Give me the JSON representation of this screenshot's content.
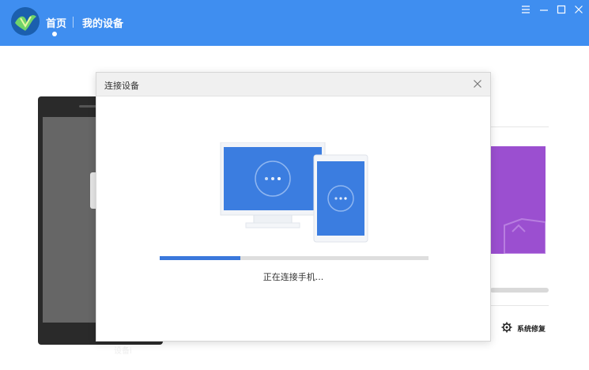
{
  "header": {
    "nav": [
      {
        "label": "首页",
        "active": true
      },
      {
        "label": "我的设备",
        "active": false
      }
    ],
    "window_controls": [
      "menu-icon",
      "minimize-icon",
      "maximize-icon",
      "close-icon"
    ]
  },
  "background": {
    "phone_label": "设备i",
    "repair_label": "系统修复"
  },
  "modal": {
    "title": "连接设备",
    "status": "正在连接手机...",
    "progress": 0.3
  },
  "colors": {
    "topbar": "#3f8ef0",
    "accent": "#3a78dc",
    "purple": "#9b4fd0",
    "screen_blue": "#3b7de0"
  }
}
